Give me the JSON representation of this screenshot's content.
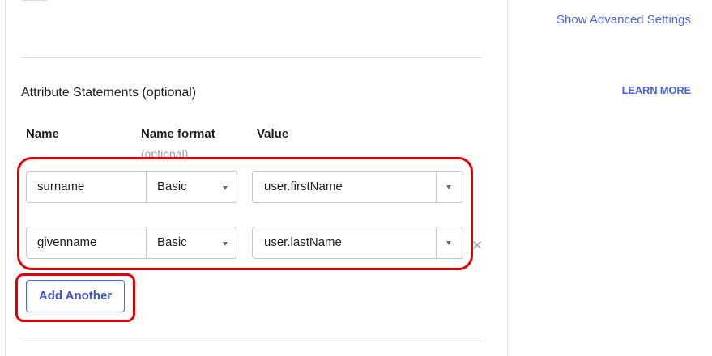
{
  "header": {
    "advanced_link": "Show Advanced Settings"
  },
  "attributes": {
    "title": "Attribute Statements (optional)",
    "learn_more": "LEARN MORE",
    "columns": {
      "name": "Name",
      "name_format": "Name format",
      "name_format_hint": "(optional)",
      "value": "Value"
    },
    "rows": [
      {
        "name": "surname",
        "format": "Basic",
        "value": "user.firstName"
      },
      {
        "name": "givenname",
        "format": "Basic",
        "value": "user.lastName"
      }
    ],
    "add_button": "Add Another"
  },
  "colors": {
    "accent": "#4c64d9",
    "highlight": "#e00000"
  }
}
